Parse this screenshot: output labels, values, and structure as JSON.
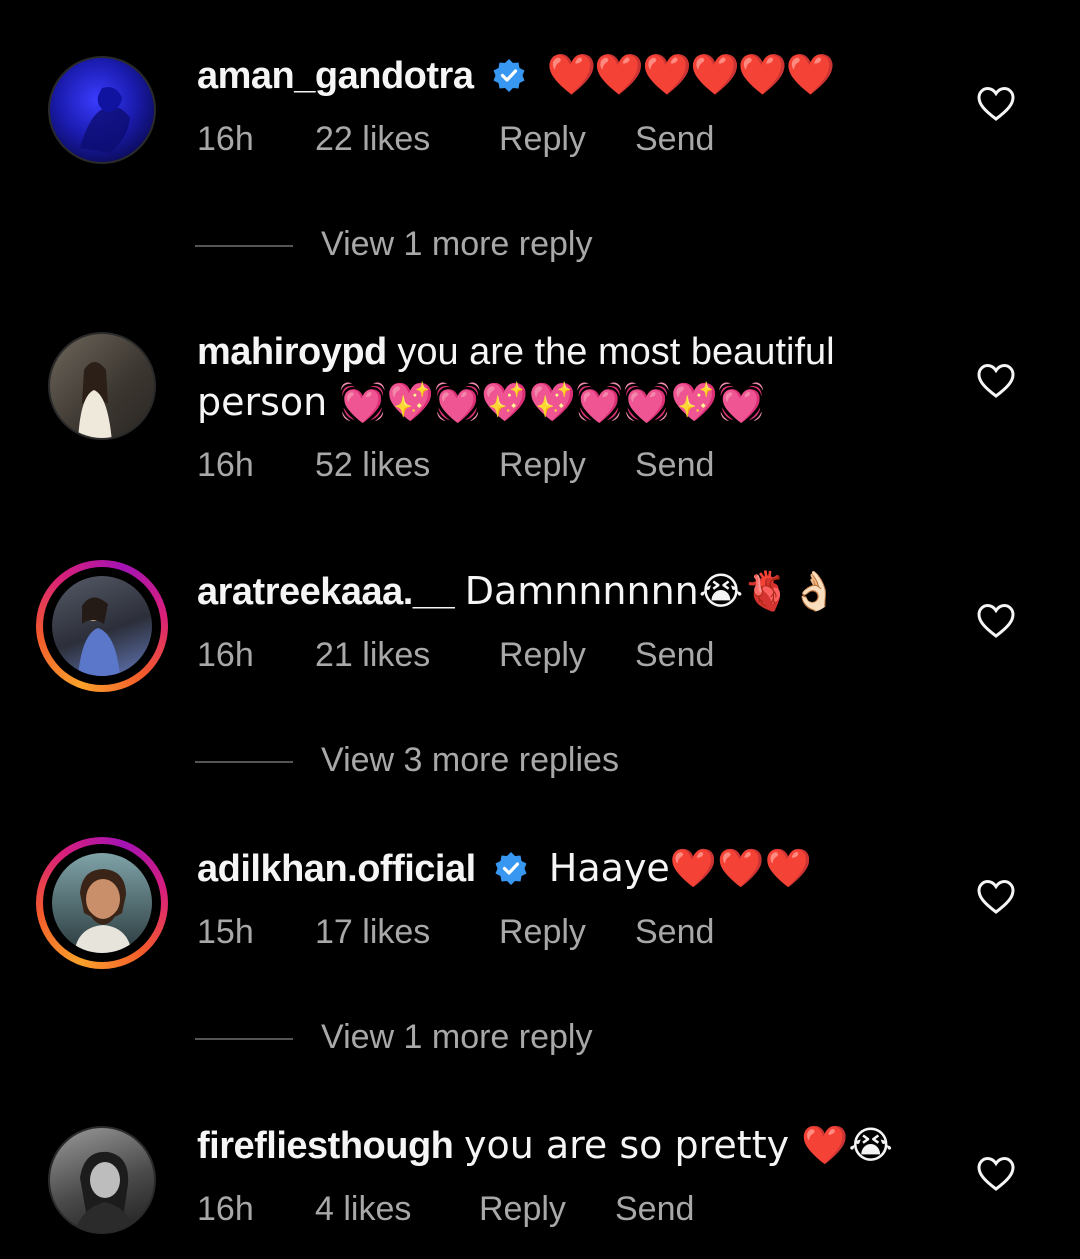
{
  "colors": {
    "background": "#000000",
    "text": "#f5f5f5",
    "muted": "#a8a8a8",
    "verified": "#3897f0",
    "heart": "#e8202a"
  },
  "comments": [
    {
      "username": "aman_gandotra",
      "verified": true,
      "text": "❤️❤️❤️❤️❤️❤️",
      "time": "16h",
      "likes": "22 likes",
      "reply": "Reply",
      "send": "Send",
      "view_more": "View 1 more reply"
    },
    {
      "username": "mahiroypd",
      "verified": false,
      "text": "you are the most beautiful",
      "text_line2": "person 💓💖💓💖💖💓💓💖💓",
      "time": "16h",
      "likes": "52 likes",
      "reply": "Reply",
      "send": "Send"
    },
    {
      "username": "aratreekaaa.__",
      "verified": false,
      "text": "Damnnnnnn😭🫀👌🏻",
      "time": "16h",
      "likes": "21 likes",
      "reply": "Reply",
      "send": "Send",
      "view_more": "View 3 more replies"
    },
    {
      "username": "adilkhan.official",
      "verified": true,
      "text": "Haaye❤️❤️❤️",
      "time": "15h",
      "likes": "17 likes",
      "reply": "Reply",
      "send": "Send",
      "view_more": "View 1 more reply"
    },
    {
      "username": "firefliesthough",
      "verified": false,
      "text": "you are so pretty ❤️😭",
      "time": "16h",
      "likes": "4 likes",
      "reply": "Reply",
      "send": "Send"
    }
  ]
}
